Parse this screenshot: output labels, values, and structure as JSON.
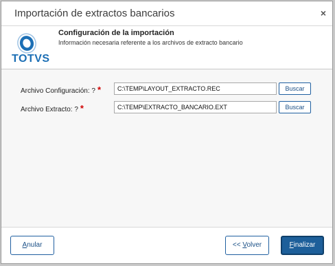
{
  "dialog": {
    "title": "Importación de extractos bancarios",
    "close_glyph": "×"
  },
  "header": {
    "logo_text": "TOTVS",
    "title": "Configuración de la importación",
    "subtitle": "Información necesaria referente a los archivos de extracto bancario"
  },
  "form": {
    "config": {
      "label": "Archivo Configuración: ?",
      "required_mark": "*",
      "value": "C:\\TEMP\\LAYOUT_EXTRACTO.REC",
      "button": "Buscar"
    },
    "extract": {
      "label": "Archivo Extracto: ?",
      "required_mark": "*",
      "value": "C:\\TEMP\\EXTRACTO_BANCARIO.EXT",
      "button": "Buscar"
    }
  },
  "footer": {
    "cancel_first": "A",
    "cancel_rest": "nular",
    "back_prefix": "<< ",
    "back_first": "V",
    "back_rest": "olver",
    "finish_first": "F",
    "finish_rest": "inalizar"
  },
  "colors": {
    "accent": "#1d5f9a",
    "required": "#d00000",
    "logo": "#1c6fb5"
  }
}
